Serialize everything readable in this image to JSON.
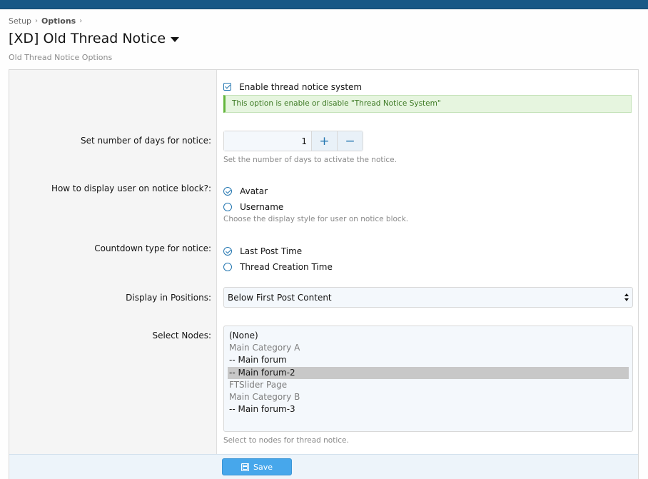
{
  "breadcrumb": {
    "items": [
      "Setup",
      "Options"
    ]
  },
  "page": {
    "title": "[XD] Old Thread Notice",
    "description": "Old Thread Notice Options"
  },
  "options": {
    "enable": {
      "label": "Enable thread notice system",
      "checked": true,
      "notice": "This option is enable or disable \"Thread Notice System\""
    },
    "days": {
      "label": "Set number of days for notice:",
      "value": "1",
      "plus": "+",
      "minus": "−",
      "hint": "Set the number of days to activate the notice."
    },
    "display_user": {
      "label": "How to display user on notice block?:",
      "options": [
        {
          "label": "Avatar",
          "checked": true
        },
        {
          "label": "Username",
          "checked": false
        }
      ],
      "hint": "Choose the display style for user on notice block."
    },
    "countdown": {
      "label": "Countdown type for notice:",
      "options": [
        {
          "label": "Last Post Time",
          "checked": true
        },
        {
          "label": "Thread Creation Time",
          "checked": false
        }
      ]
    },
    "positions": {
      "label": "Display in Positions:",
      "selected": "Below First Post Content"
    },
    "nodes": {
      "label": "Select Nodes:",
      "items": [
        {
          "label": "(None)",
          "type": "option",
          "selected": false
        },
        {
          "label": "Main Category A",
          "type": "group",
          "selected": false
        },
        {
          "label": "-- Main forum",
          "type": "option",
          "selected": false
        },
        {
          "label": "-- Main forum-2",
          "type": "option",
          "selected": true
        },
        {
          "label": "FTSlider Page",
          "type": "group",
          "selected": false
        },
        {
          "label": "Main Category B",
          "type": "group",
          "selected": false
        },
        {
          "label": "-- Main forum-3",
          "type": "option",
          "selected": false
        }
      ],
      "hint": "Select to nodes for thread notice."
    }
  },
  "footer": {
    "save_label": "Save"
  },
  "colors": {
    "header": "#185886",
    "accent": "#2577b1",
    "save_button": "#47a7eb",
    "success_bg": "#e6f5df"
  }
}
